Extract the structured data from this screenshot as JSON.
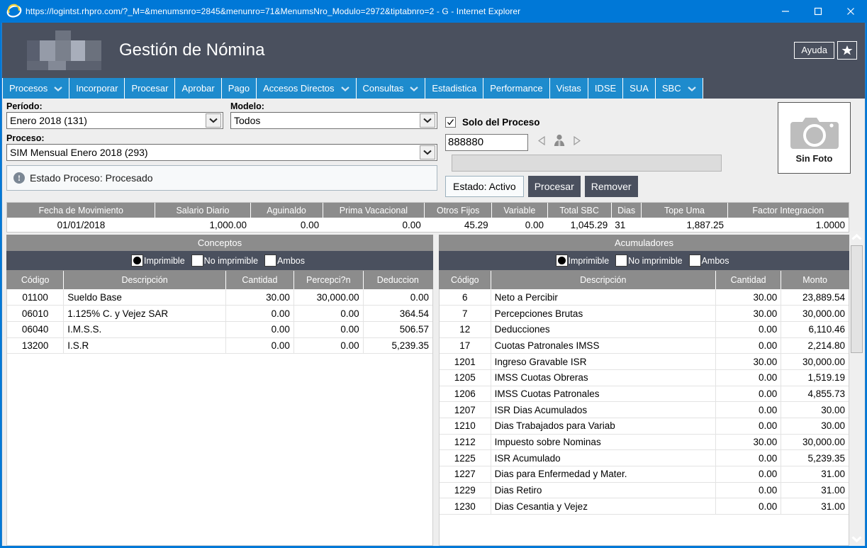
{
  "titlebar": {
    "url_title": "https://logintst.rhpro.com/?_M=&menumsnro=2845&menunro=71&MenumsNro_Modulo=2972&tiptabnro=2 - G - Internet Explorer",
    "browser_icon": "internet-explorer-icon",
    "minimize": "minimize-icon",
    "maximize": "maximize-icon",
    "close": "close-icon"
  },
  "header": {
    "app_title": "Gestión de Nómina",
    "help_label": "Ayuda",
    "favorite_icon": "star-icon",
    "logo": "company-logo-blurred"
  },
  "nav": [
    {
      "label": "Procesos",
      "caret": true
    },
    {
      "label": "Incorporar",
      "caret": false
    },
    {
      "label": "Procesar",
      "caret": false
    },
    {
      "label": "Aprobar",
      "caret": false
    },
    {
      "label": "Pago",
      "caret": false
    },
    {
      "label": "Accesos Directos",
      "caret": true
    },
    {
      "label": "Consultas",
      "caret": true
    },
    {
      "label": "Estadistica",
      "caret": false
    },
    {
      "label": "Performance",
      "caret": false
    },
    {
      "label": "Vistas",
      "caret": false
    },
    {
      "label": "IDSE",
      "caret": false
    },
    {
      "label": "SUA",
      "caret": false
    },
    {
      "label": "SBC",
      "caret": true
    }
  ],
  "form": {
    "periodo_label": "Período:",
    "periodo_value": "Enero 2018 (131)",
    "modelo_label": "Modelo:",
    "modelo_value": "Todos",
    "proceso_label": "Proceso:",
    "proceso_value": "SIM Mensual Enero 2018 (293)",
    "estado_proceso": "Estado Proceso: Procesado",
    "solo_del_proceso_label": "Solo del Proceso",
    "solo_del_proceso_checked": "✓",
    "employee_number": "888880",
    "employee_name": "",
    "estado_activo": "Estado: Activo",
    "procesar_label": "Procesar",
    "remover_label": "Remover",
    "photo_label": "Sin Foto",
    "prev_icon": "prev-triangle-icon",
    "person_icon": "person-icon",
    "next_icon": "next-triangle-icon"
  },
  "summary": {
    "headers": [
      "Fecha de Movimiento",
      "Salario Diario",
      "Aguinaldo",
      "Prima Vacacional",
      "Otros Fijos",
      "Variable",
      "Total SBC",
      "Dias",
      "Tope Uma",
      "Factor Integracion"
    ],
    "row": [
      "01/01/2018",
      "1,000.00",
      "0.00",
      "0.00",
      "45.29",
      "0.00",
      "1,045.29",
      "31",
      "1,887.25",
      "1.0000"
    ]
  },
  "conceptos": {
    "title": "Conceptos",
    "filters": [
      {
        "label": "Imprimible",
        "selected": true
      },
      {
        "label": "No imprimible",
        "selected": false
      },
      {
        "label": "Ambos",
        "selected": false
      }
    ],
    "headers": [
      "Código",
      "Descripción",
      "Cantidad",
      "Percepci?n",
      "Deduccion"
    ],
    "rows": [
      {
        "codigo": "01100",
        "descripcion": "Sueldo Base",
        "cantidad": "30.00",
        "percepcion": "30,000.00",
        "deduccion": "0.00"
      },
      {
        "codigo": "06010",
        "descripcion": "1.125% C. y Vejez SAR",
        "cantidad": "0.00",
        "percepcion": "0.00",
        "deduccion": "364.54"
      },
      {
        "codigo": "06040",
        "descripcion": "I.M.S.S.",
        "cantidad": "0.00",
        "percepcion": "0.00",
        "deduccion": "506.57"
      },
      {
        "codigo": "13200",
        "descripcion": "I.S.R",
        "cantidad": "0.00",
        "percepcion": "0.00",
        "deduccion": "5,239.35"
      }
    ]
  },
  "acumuladores": {
    "title": "Acumuladores",
    "filters": [
      {
        "label": "Imprimible",
        "selected": true
      },
      {
        "label": "No imprimible",
        "selected": false
      },
      {
        "label": "Ambos",
        "selected": false
      }
    ],
    "headers": [
      "Código",
      "Descripción",
      "Cantidad",
      "Monto"
    ],
    "rows": [
      {
        "codigo": "6",
        "descripcion": "Neto a Percibir",
        "cantidad": "30.00",
        "monto": "23,889.54"
      },
      {
        "codigo": "7",
        "descripcion": "Percepciones Brutas",
        "cantidad": "30.00",
        "monto": "30,000.00"
      },
      {
        "codigo": "12",
        "descripcion": "Deducciones",
        "cantidad": "0.00",
        "monto": "6,110.46"
      },
      {
        "codigo": "17",
        "descripcion": "Cuotas Patronales IMSS",
        "cantidad": "0.00",
        "monto": "2,214.80"
      },
      {
        "codigo": "1201",
        "descripcion": "Ingreso Gravable ISR",
        "cantidad": "30.00",
        "monto": "30,000.00"
      },
      {
        "codigo": "1205",
        "descripcion": "IMSS Cuotas Obreras",
        "cantidad": "0.00",
        "monto": "1,519.19"
      },
      {
        "codigo": "1206",
        "descripcion": "IMSS Cuotas Patronales",
        "cantidad": "0.00",
        "monto": "4,855.73"
      },
      {
        "codigo": "1207",
        "descripcion": "ISR Dias Acumulados",
        "cantidad": "0.00",
        "monto": "30.00"
      },
      {
        "codigo": "1210",
        "descripcion": "Dias Trabajados para Variab",
        "cantidad": "0.00",
        "monto": "30.00"
      },
      {
        "codigo": "1212",
        "descripcion": "Impuesto sobre Nominas",
        "cantidad": "30.00",
        "monto": "30,000.00"
      },
      {
        "codigo": "1225",
        "descripcion": "ISR Acumulado",
        "cantidad": "0.00",
        "monto": "5,239.35"
      },
      {
        "codigo": "1227",
        "descripcion": "Dias para Enfermedad y Mater.",
        "cantidad": "0.00",
        "monto": "31.00"
      },
      {
        "codigo": "1229",
        "descripcion": "Dias Retiro",
        "cantidad": "0.00",
        "monto": "31.00"
      },
      {
        "codigo": "1230",
        "descripcion": "Dias Cesantia y Vejez",
        "cantidad": "0.00",
        "monto": "31.00"
      }
    ]
  },
  "colors": {
    "titlebar": "#0078d7",
    "header_dark": "#4a505e",
    "nav_blue": "#1e8bcd",
    "table_header_gray": "#8c8c8c",
    "page_bg": "#eeeeee"
  }
}
